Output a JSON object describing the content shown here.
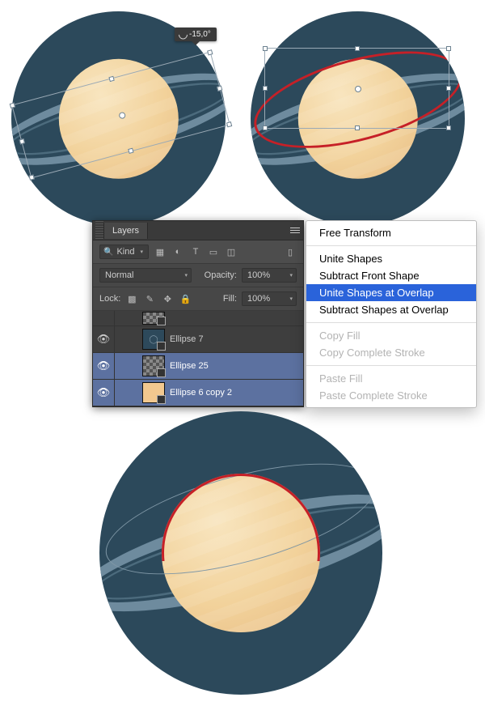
{
  "tooltip": {
    "angle": "-15,0°"
  },
  "layers_panel": {
    "title": "Layers",
    "kind_label": "Kind",
    "blend_mode": "Normal",
    "opacity_label": "Opacity:",
    "opacity_value": "100%",
    "lock_label": "Lock:",
    "fill_label": "Fill:",
    "fill_value": "100%",
    "items": [
      {
        "name": "Ellipse 7"
      },
      {
        "name": "Ellipse 25"
      },
      {
        "name": "Ellipse 6 copy 2"
      }
    ]
  },
  "context_menu": {
    "items": [
      {
        "label": "Free Transform",
        "kind": "item"
      },
      {
        "kind": "sep"
      },
      {
        "label": "Unite Shapes",
        "kind": "item"
      },
      {
        "label": "Subtract Front Shape",
        "kind": "item"
      },
      {
        "label": "Unite Shapes at Overlap",
        "kind": "highlight"
      },
      {
        "label": "Subtract Shapes at Overlap",
        "kind": "item"
      },
      {
        "kind": "sep"
      },
      {
        "label": "Copy Fill",
        "kind": "disabled"
      },
      {
        "label": "Copy Complete Stroke",
        "kind": "disabled"
      },
      {
        "kind": "sep"
      },
      {
        "label": "Paste Fill",
        "kind": "disabled"
      },
      {
        "label": "Paste Complete Stroke",
        "kind": "disabled"
      }
    ]
  }
}
